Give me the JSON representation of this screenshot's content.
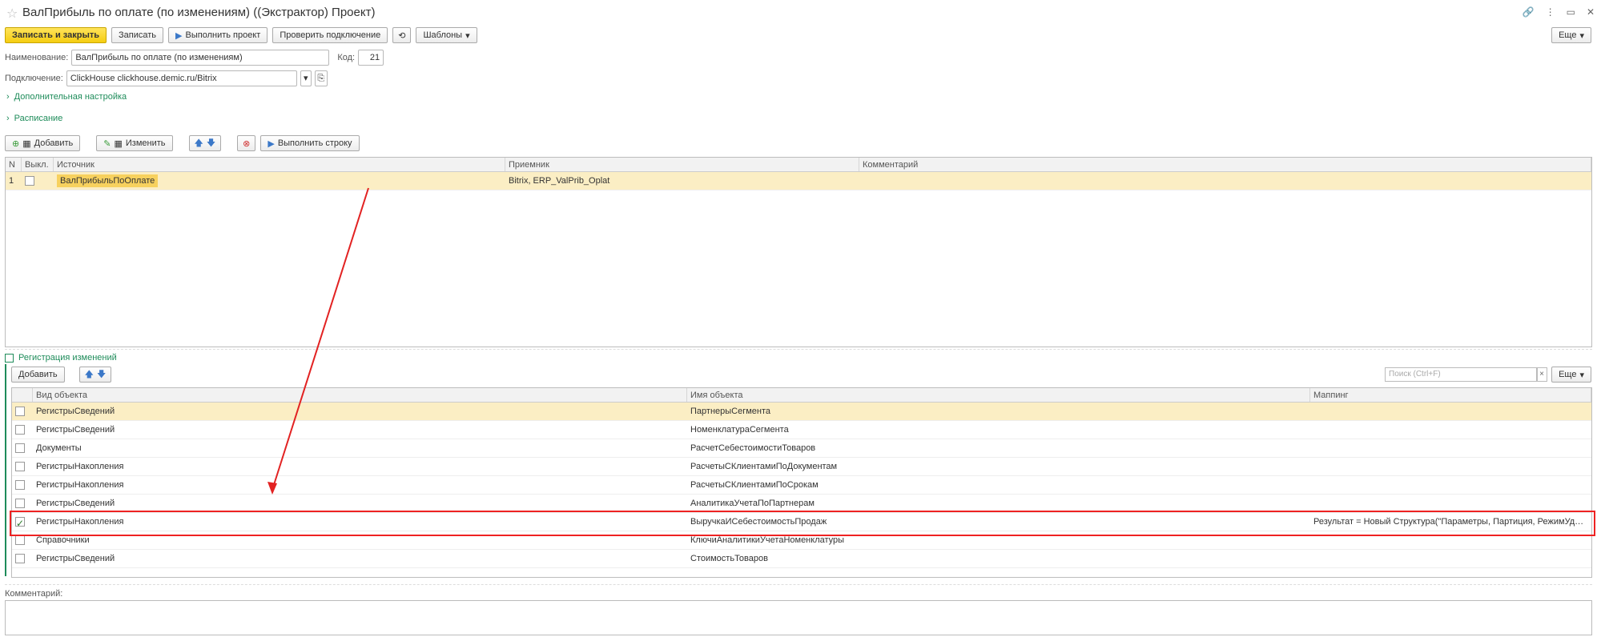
{
  "window": {
    "title": "ВалПрибыль по оплате (по изменениям) ((Экстрактор) Проект)"
  },
  "toolbar": {
    "save_close": "Записать и закрыть",
    "save": "Записать",
    "run_project": "Выполнить проект",
    "check_connection": "Проверить подключение",
    "templates": "Шаблоны",
    "more": "Еще"
  },
  "form": {
    "name_label": "Наименование:",
    "name_value": "ВалПрибыль по оплате (по изменениям)",
    "code_label": "Код:",
    "code_value": "21",
    "connection_label": "Подключение:",
    "connection_value": "ClickHouse clickhouse.demic.ru/Bitrix"
  },
  "sections": {
    "extra_settings": "Дополнительная настройка",
    "schedule": "Расписание",
    "change_registration": "Регистрация изменений"
  },
  "rows_toolbar": {
    "add": "Добавить",
    "edit": "Изменить",
    "run_row": "Выполнить строку"
  },
  "top_table": {
    "columns": [
      "N",
      "Выкл.",
      "Источник",
      "Приемник",
      "Комментарий"
    ],
    "rows": [
      {
        "n": "1",
        "disabled": false,
        "source": "ВалПрибыльПоОплате",
        "target": "Bitrix, ERP_ValPrib_Oplat",
        "comment": ""
      }
    ]
  },
  "reg_toolbar": {
    "add": "Добавить",
    "search_placeholder": "Поиск (Ctrl+F)",
    "more": "Еще"
  },
  "reg_table": {
    "columns": [
      "",
      "Вид объекта",
      "Имя объекта",
      "Маппинг"
    ],
    "rows": [
      {
        "checked": false,
        "kind": "РегистрыСведений",
        "name": "ПартнерыСегмента",
        "mapping": ""
      },
      {
        "checked": false,
        "kind": "РегистрыСведений",
        "name": "НоменклатураСегмента",
        "mapping": ""
      },
      {
        "checked": false,
        "kind": "Документы",
        "name": "РасчетСебестоимостиТоваров",
        "mapping": ""
      },
      {
        "checked": false,
        "kind": "РегистрыНакопления",
        "name": "РасчетыСКлиентамиПоДокументам",
        "mapping": ""
      },
      {
        "checked": false,
        "kind": "РегистрыНакопления",
        "name": "РасчетыСКлиентамиПоСрокам",
        "mapping": ""
      },
      {
        "checked": false,
        "kind": "РегистрыСведений",
        "name": "АналитикаУчетаПоПартнерам",
        "mapping": ""
      },
      {
        "checked": true,
        "kind": "РегистрыНакопления",
        "name": "ВыручкаИСебестоимостьПродаж",
        "mapping": "Результат = Новый Структура(\"Параметры, Партиция, РежимУдалени..."
      },
      {
        "checked": false,
        "kind": "Справочники",
        "name": "КлючиАналитикиУчетаНоменклатуры",
        "mapping": ""
      },
      {
        "checked": false,
        "kind": "РегистрыСведений",
        "name": "СтоимостьТоваров",
        "mapping": ""
      }
    ]
  },
  "comment": {
    "label": "Комментарий:"
  },
  "colors": {
    "accent_yellow": "#f5cd11",
    "link_green": "#1e8c5a",
    "selection": "#fbeec4",
    "annotation_red": "#e22222"
  }
}
